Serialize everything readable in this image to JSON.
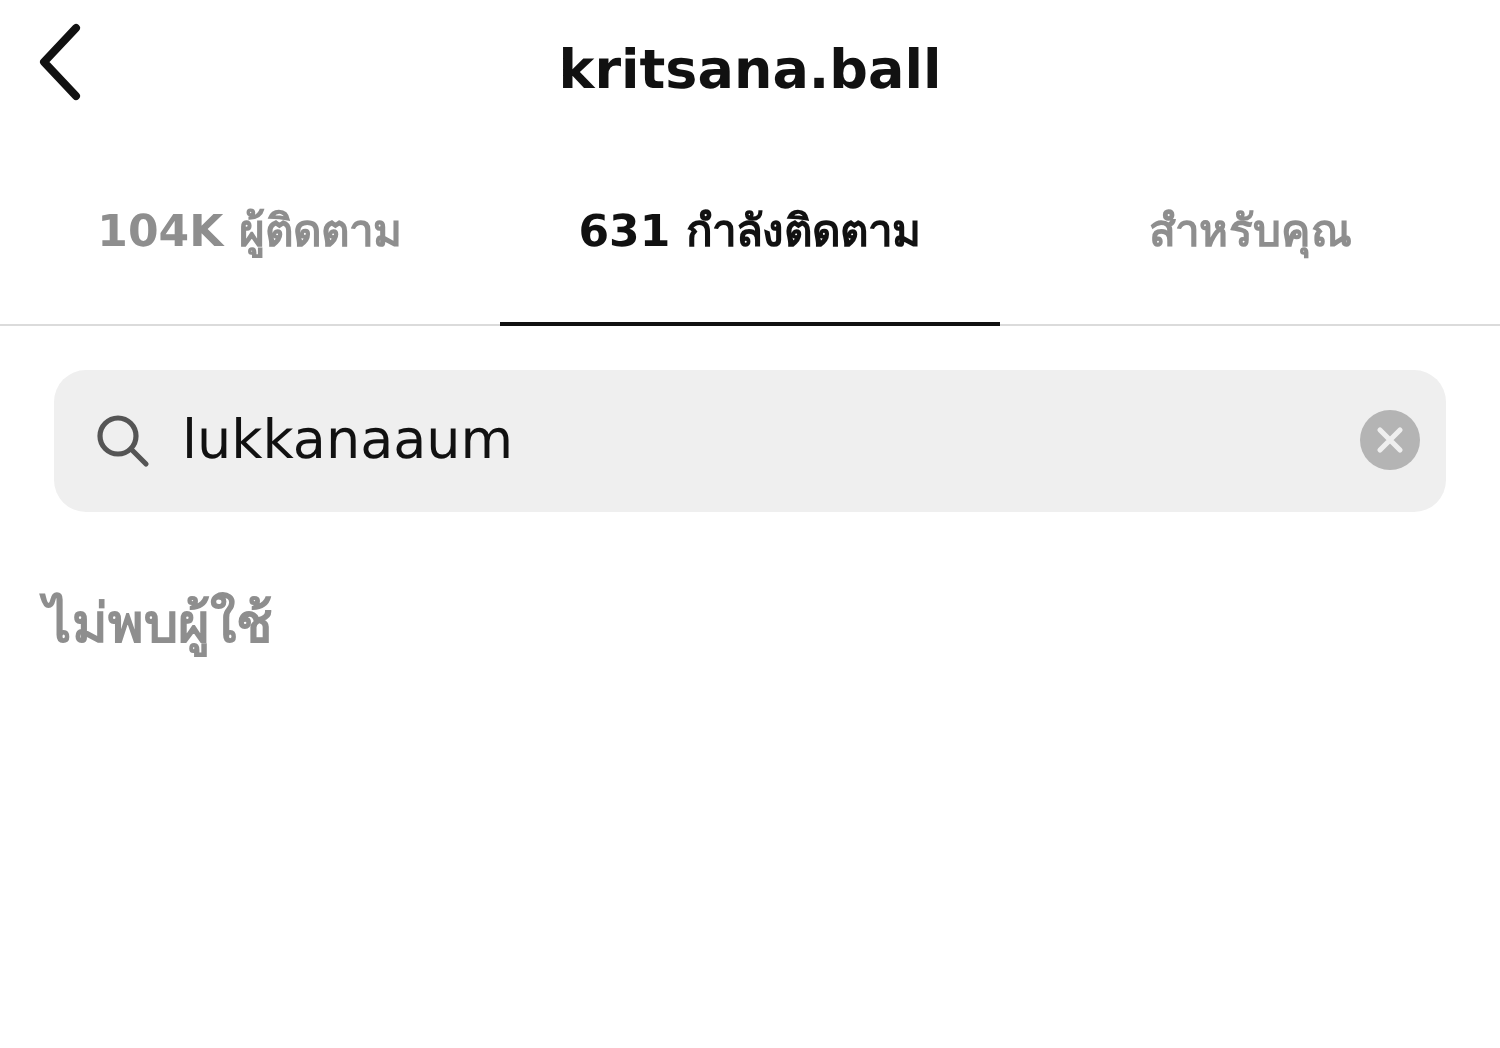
{
  "header": {
    "title": "kritsana.ball"
  },
  "tabs": [
    {
      "label": "104K ผู้ติดตาม",
      "selected": false
    },
    {
      "label": "631 กำลังติดตาม",
      "selected": true
    },
    {
      "label": "สำหรับคุณ",
      "selected": false
    }
  ],
  "search": {
    "value": "lukkanaaum"
  },
  "message": "ไม่พบผู้ใช้"
}
